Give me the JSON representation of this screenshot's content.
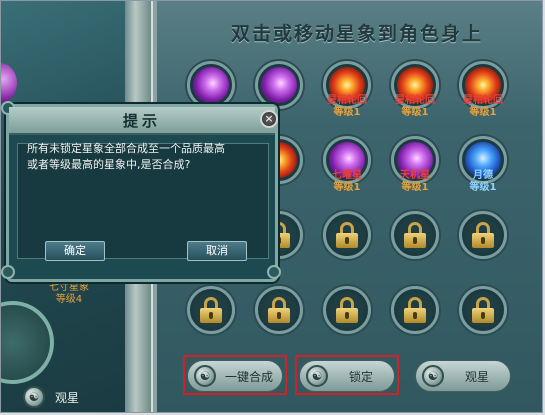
{
  "header": {
    "title": "双击或移动星象到角色身上"
  },
  "left": {
    "caption_line1": "七寸星象",
    "caption_line2": "等级4",
    "guan_label": "观星"
  },
  "grid": {
    "row1": [
      {
        "name": "",
        "color": "purple"
      },
      {
        "name": "",
        "color": "purple"
      },
      {
        "name": "星相轮回",
        "level": "等级1",
        "color": "red"
      },
      {
        "name": "星相轮回",
        "level": "等级1",
        "color": "red"
      },
      {
        "name": "星相轮回",
        "level": "等级1",
        "color": "red"
      }
    ],
    "row2": [
      {
        "name": "",
        "color": "purple"
      },
      {
        "name": "",
        "color": "red"
      },
      {
        "name": "七曜星",
        "level": "等级1",
        "color": "purple"
      },
      {
        "name": "天机星",
        "level": "等级1",
        "color": "purple"
      },
      {
        "name": "月德",
        "level": "等级1",
        "color": "blue"
      }
    ]
  },
  "buttons": {
    "combine": "一键合成",
    "lock": "锁定",
    "observe": "观星"
  },
  "dialog": {
    "title": "提示",
    "close": "×",
    "message_line1": "所有未锁定星象全部合成至一个品质最高",
    "message_line2": "或者等级最高的星象中,是否合成?",
    "confirm": "确定",
    "cancel": "取消"
  },
  "colors": {
    "highlight": "#d0202a",
    "name_red": "#e8403a",
    "level_orange": "#e6a23a",
    "name_blue": "#8fd4ff"
  }
}
